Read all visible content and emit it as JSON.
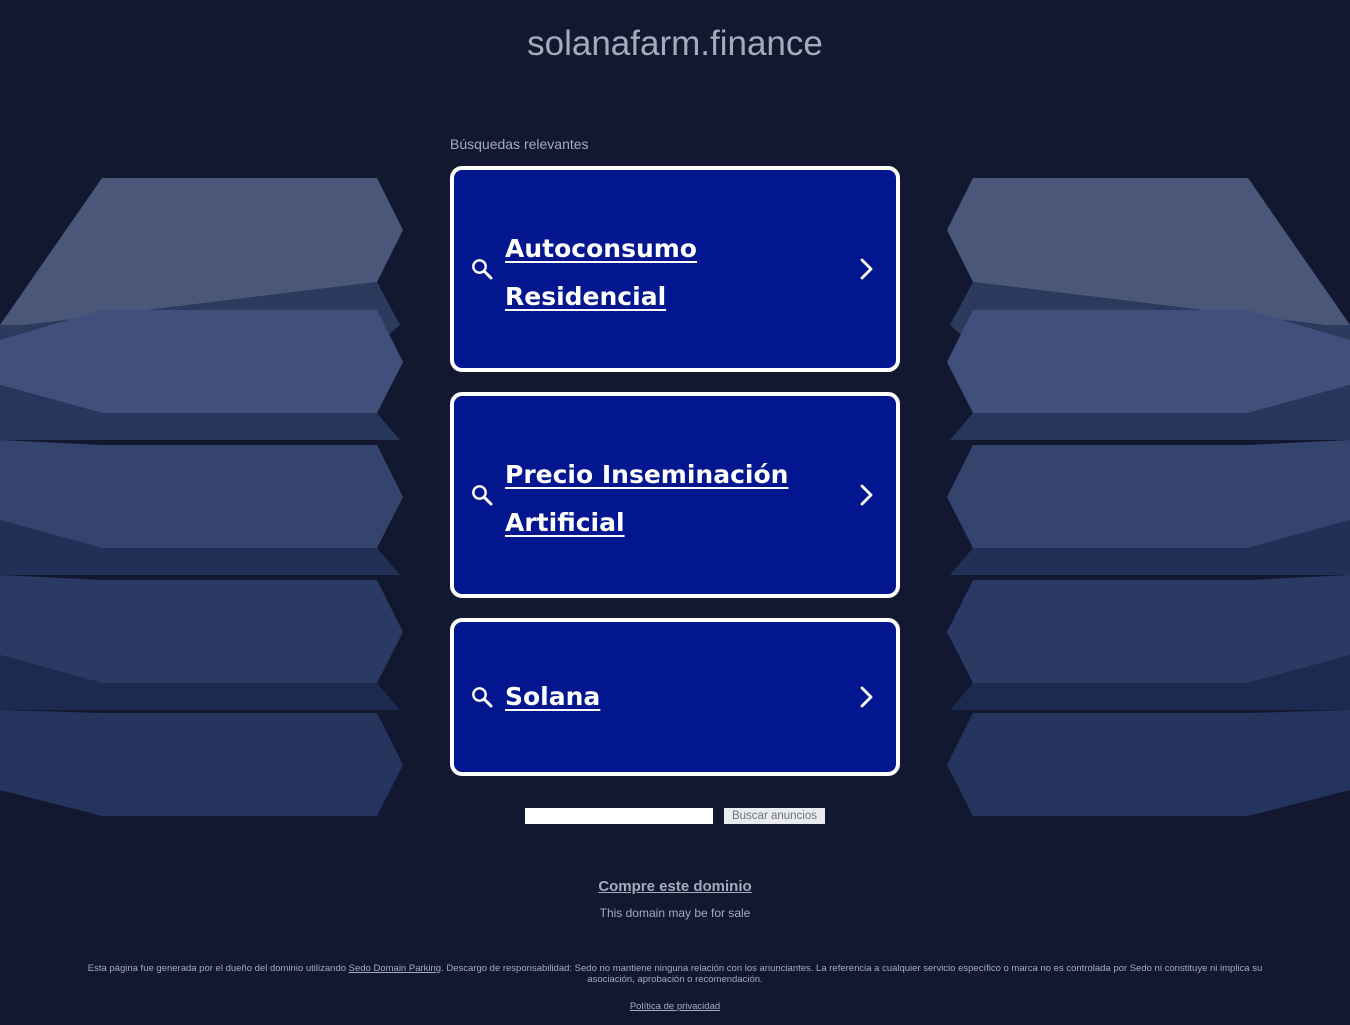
{
  "page": {
    "domain_title": "solanafarm.finance",
    "related_searches_label": "Búsquedas relevantes"
  },
  "results": [
    {
      "label": "Autoconsumo Residencial",
      "icon": "search-icon",
      "action_icon": "chevron-right-icon"
    },
    {
      "label": "Precio Inseminación Artificial",
      "icon": "search-icon",
      "action_icon": "chevron-right-icon"
    },
    {
      "label": "Solana",
      "icon": "search-icon",
      "action_icon": "chevron-right-icon"
    }
  ],
  "search": {
    "value": "",
    "button_label": "Buscar anuncios"
  },
  "footer": {
    "buy_domain_link": "Compre este dominio",
    "for_sale_text": "This domain may be for sale",
    "disclaimer_before": "Esta página fue generada por el dueño del dominio utilizando ",
    "disclaimer_link": "Sedo Domain Parking",
    "disclaimer_after": ". Descargo de responsabilidad: Sedo no mantiene ninguna relación con los anunciantes. La referencia a cualquier servicio específico o marca no es controlada por Sedo ni constituye ni implica su asociación, aprobación o recomendación.",
    "privacy_link": "Política de privacidad"
  },
  "colors": {
    "background": "#111830",
    "card_fill": "#021690",
    "card_border": "#ffffff",
    "muted_text": "#a5abbb",
    "decor_light": "#4d5a7c"
  }
}
